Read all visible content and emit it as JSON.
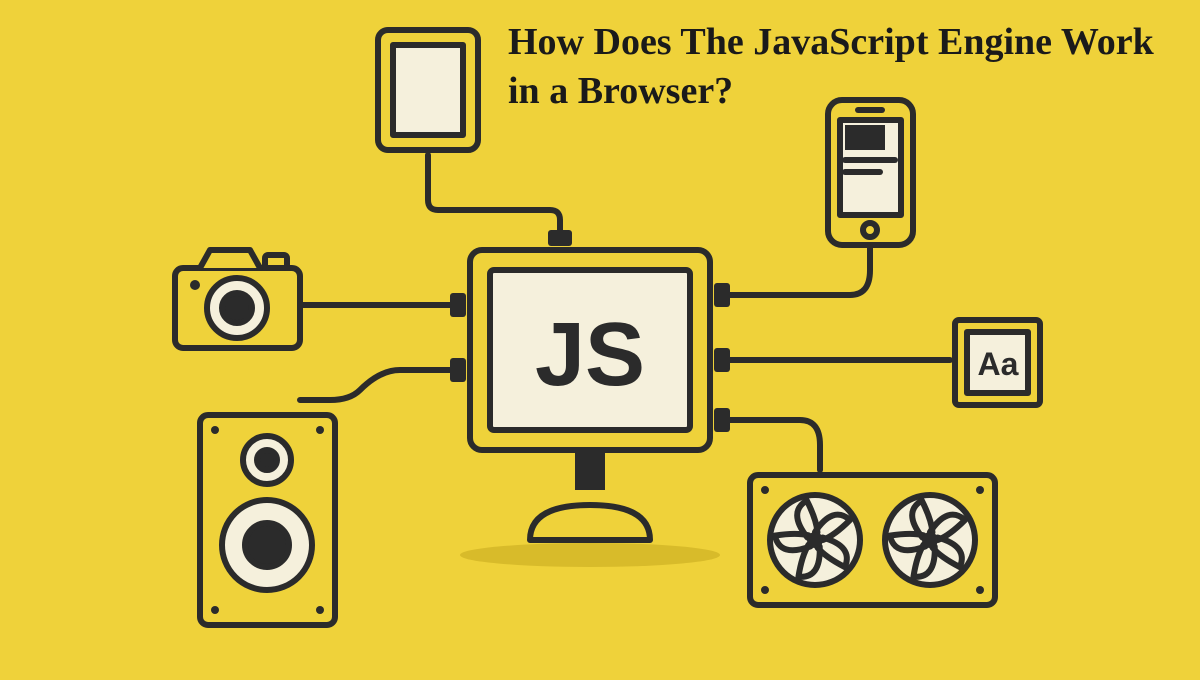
{
  "title": "How Does The JavaScript Engine Work in a Browser?",
  "monitor": {
    "label": "JS"
  },
  "font_box": {
    "label": "Aa"
  },
  "colors": {
    "background": "#efd23a",
    "stroke": "#2b2b2b",
    "shadow": "#d8bb2a",
    "light": "#f5f0dc"
  },
  "devices": [
    {
      "name": "tablet",
      "position": "top"
    },
    {
      "name": "camera",
      "position": "left-upper"
    },
    {
      "name": "smartphone",
      "position": "right-upper"
    },
    {
      "name": "font-typography",
      "position": "right-middle"
    },
    {
      "name": "speaker",
      "position": "left-lower"
    },
    {
      "name": "cooling-fans",
      "position": "right-lower"
    }
  ]
}
